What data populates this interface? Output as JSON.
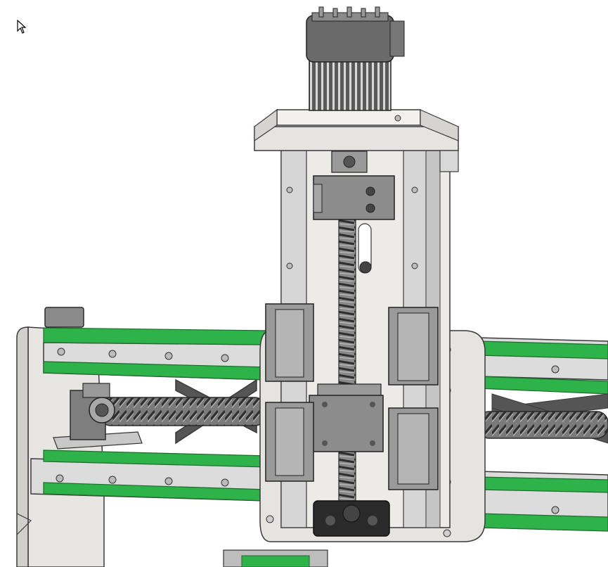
{
  "viewport": {
    "background": "#ffffff",
    "model": "cnc-gantry-z-axis-assembly"
  },
  "palette": {
    "rail_green": "#2db34a",
    "rail_green_dark": "#1f8a36",
    "plate_gray": "#e6e4e0",
    "plate_light": "#f2f1ee",
    "aluminum": "#cfcfcf",
    "steel_dark": "#6f6f6f",
    "block_gray": "#8e8e8e",
    "black_part": "#2a2a2a",
    "edge": "#3a3a3a"
  },
  "cursor": {
    "icon": "mouse-pointer-icon"
  }
}
